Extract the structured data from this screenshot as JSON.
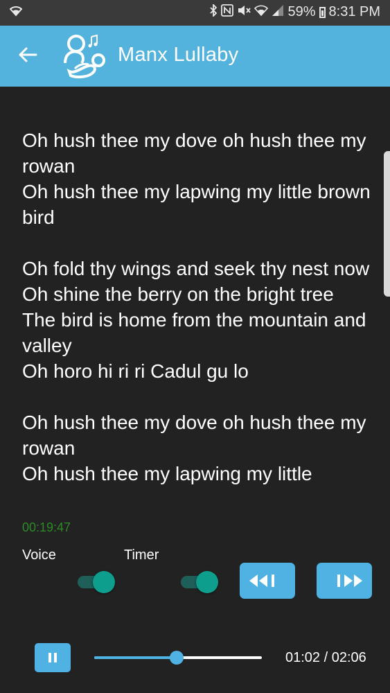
{
  "status_bar": {
    "icons": [
      "wifi-icon",
      "bluetooth-icon",
      "nfc-icon",
      "mute-icon",
      "signal-icon",
      "battery-icon"
    ],
    "battery": "59%",
    "time": "8:31 PM"
  },
  "app_bar": {
    "title": "Manx Lullaby",
    "back_icon": "arrow-left-icon",
    "logo_icon": "lullaby-logo-icon",
    "background": "#54b3dd"
  },
  "lyrics": {
    "text": "Oh hush thee my dove oh hush thee my rowan\nOh hush thee my lapwing my little brown bird\n\nOh fold thy wings and seek thy nest now\nOh shine the berry on the bright tree\nThe bird is home from the mountain and valley\nOh horo hi ri ri Cadul gu lo\n\nOh hush thee my dove oh hush thee my rowan\nOh hush thee my lapwing my little"
  },
  "sleep_timer": {
    "remaining": "00:19:47",
    "color": "#2d8a26"
  },
  "controls": {
    "voice_label": "Voice",
    "timer_label": "Timer",
    "voice_on": true,
    "timer_on": true,
    "prev_icon": "rewind-icon",
    "next_icon": "fast-forward-icon",
    "accent": "#4fb2e2"
  },
  "playback": {
    "pause_icon": "pause-icon",
    "progress": 0.49,
    "current": "01:02",
    "total": "02:06",
    "readout": "01:02 / 02:06"
  }
}
